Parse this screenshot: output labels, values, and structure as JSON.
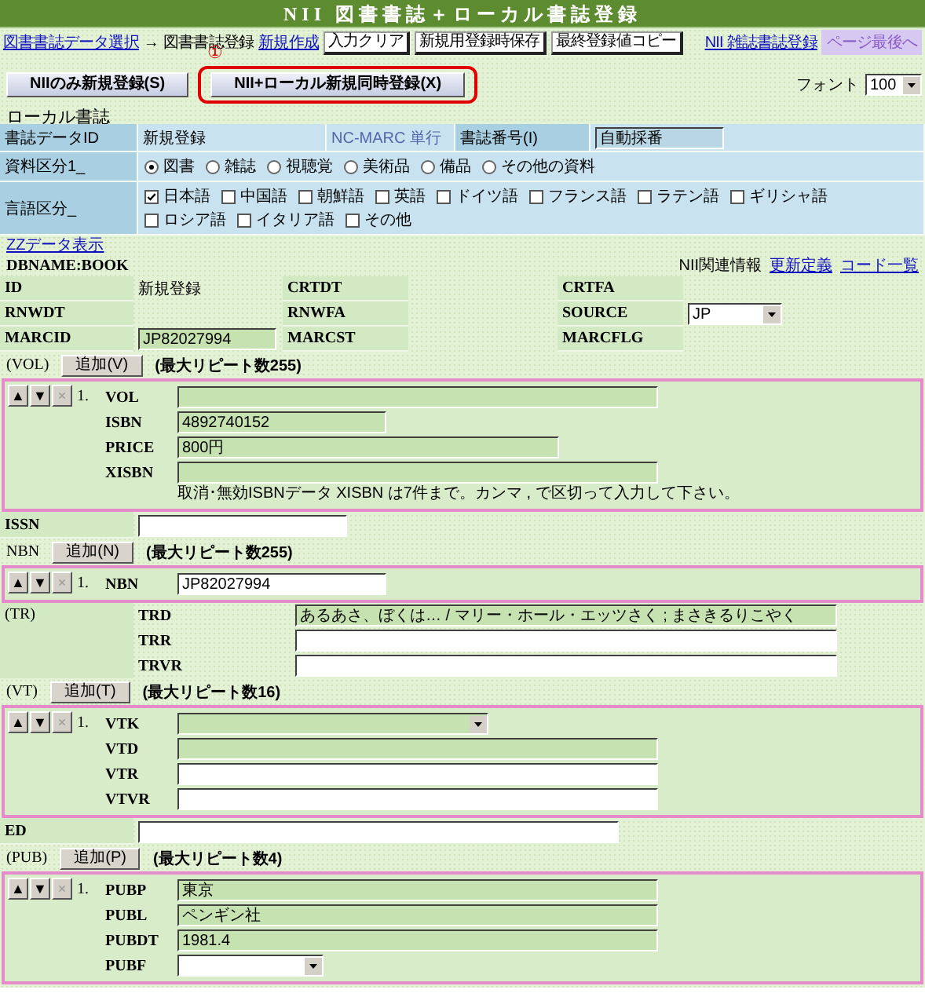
{
  "header": {
    "title": "NII 図書書誌＋ローカル書誌登録"
  },
  "nav": {
    "back_link": "図書書誌データ選択",
    "arrow": "→",
    "current": "図書書誌登録",
    "callout": "①",
    "new_link": "新規作成",
    "buttons": [
      "入力クリア",
      "新規用登録時保存",
      "最終登録値コピー"
    ],
    "serial_link": "NII 雑誌書誌登録",
    "bottom_link": "ページ最後へ"
  },
  "actions": {
    "buttons": [
      {
        "label": "NIIのみ新規登録(S)",
        "highlighted": false
      },
      {
        "label": "NII+ローカル新規同時登録(X)",
        "highlighted": true
      }
    ],
    "font_label": "フォント",
    "font_value": "100"
  },
  "local": {
    "heading": "ローカル書誌",
    "id_row": {
      "label": "書誌データID",
      "value": "新規登録",
      "source": "NC-MARC 単行",
      "number_label": "書誌番号(I)",
      "number_value": "自動採番"
    },
    "type_row": {
      "label": "資料区分1_",
      "options": [
        {
          "label": "図書",
          "selected": true
        },
        {
          "label": "雑誌",
          "selected": false
        },
        {
          "label": "視聴覚",
          "selected": false
        },
        {
          "label": "美術品",
          "selected": false
        },
        {
          "label": "備品",
          "selected": false
        },
        {
          "label": "その他の資料",
          "selected": false
        }
      ]
    },
    "lang_row": {
      "label": "言語区分_",
      "options": [
        {
          "label": "日本語",
          "checked": true
        },
        {
          "label": "中国語",
          "checked": false
        },
        {
          "label": "朝鮮語",
          "checked": false
        },
        {
          "label": "英語",
          "checked": false
        },
        {
          "label": "ドイツ語",
          "checked": false
        },
        {
          "label": "フランス語",
          "checked": false
        },
        {
          "label": "ラテン語",
          "checked": false
        },
        {
          "label": "ギリシャ語",
          "checked": false
        },
        {
          "label": "ロシア語",
          "checked": false
        },
        {
          "label": "イタリア語",
          "checked": false
        },
        {
          "label": "その他",
          "checked": false
        }
      ]
    }
  },
  "zz_link": "ZZデータ表示",
  "record": {
    "dbname": "DBNAME:BOOK",
    "info_label": "NII関連情報",
    "links": [
      "更新定義",
      "コード一覧"
    ],
    "rows": [
      {
        "cells": [
          {
            "label": "ID",
            "kind": "text",
            "value": "新規登録"
          },
          {
            "label": "CRTDT",
            "kind": "text"
          },
          {
            "label": "CRTFA",
            "kind": "text"
          }
        ]
      },
      {
        "cells": [
          {
            "label": "RNWDT",
            "kind": "text"
          },
          {
            "label": "RNWFA",
            "kind": "text"
          },
          {
            "label": "SOURCE",
            "kind": "select",
            "value": "JP"
          }
        ]
      },
      {
        "cells": [
          {
            "label": "MARCID",
            "kind": "input",
            "value": "JP82027994"
          },
          {
            "label": "MARCST",
            "kind": "text"
          },
          {
            "label": "MARCFLG",
            "kind": "text"
          }
        ]
      }
    ]
  },
  "sections": [
    {
      "kind": "repeat",
      "label": "(VOL)",
      "add_button": "追加(V)",
      "limit": "(最大リピート数255)",
      "entries": [
        {
          "controls": [
            {
              "label": "▲",
              "disabled": false
            },
            {
              "label": "▼",
              "disabled": false
            },
            {
              "label": "×",
              "disabled": true
            }
          ],
          "index": "1.",
          "fields": [
            {
              "label": "VOL",
              "kind": "input",
              "shaded": true
            },
            {
              "label": "ISBN",
              "kind": "input",
              "shaded": true,
              "value": "4892740152"
            },
            {
              "label": "PRICE",
              "kind": "input",
              "shaded": true,
              "value": "800円"
            },
            {
              "label": "XISBN",
              "kind": "input",
              "shaded": true
            }
          ],
          "note": "取消･無効ISBNデータ XISBN は7件まで。カンマ , で区切って入力して下さい。"
        }
      ]
    },
    {
      "kind": "field",
      "label": "ISSN",
      "shaded": false
    },
    {
      "kind": "repeat",
      "label": "NBN",
      "add_button": "追加(N)",
      "limit": "(最大リピート数255)",
      "entries": [
        {
          "controls": [
            {
              "label": "▲",
              "disabled": false
            },
            {
              "label": "▼",
              "disabled": false
            },
            {
              "label": "×",
              "disabled": true
            }
          ],
          "index": "1.",
          "fields": [
            {
              "label": "NBN",
              "kind": "input",
              "shaded": false,
              "value": "JP82027994"
            }
          ]
        }
      ]
    },
    {
      "kind": "group",
      "label": "(TR)",
      "fields": [
        {
          "label": "TRD",
          "shaded": true,
          "value": "あるあさ、ぼくは… / マリー・ホール・エッツさく ; まさきるりこやく"
        },
        {
          "label": "TRR",
          "shaded": false
        },
        {
          "label": "TRVR",
          "shaded": false
        }
      ]
    },
    {
      "kind": "repeat",
      "label": "(VT)",
      "add_button": "追加(T)",
      "limit": "(最大リピート数16)",
      "entries": [
        {
          "controls": [
            {
              "label": "▲",
              "disabled": false
            },
            {
              "label": "▼",
              "disabled": false
            },
            {
              "label": "×",
              "disabled": true
            }
          ],
          "index": "1.",
          "fields": [
            {
              "label": "VTK",
              "kind": "select",
              "shaded": true
            },
            {
              "label": "VTD",
              "kind": "input",
              "shaded": true
            },
            {
              "label": "VTR",
              "kind": "input",
              "shaded": false
            },
            {
              "label": "VTVR",
              "kind": "input",
              "shaded": false
            }
          ]
        }
      ]
    },
    {
      "kind": "field",
      "label": "ED",
      "shaded": false
    },
    {
      "kind": "repeat",
      "label": "(PUB)",
      "add_button": "追加(P)",
      "limit": "(最大リピート数4)",
      "entries": [
        {
          "controls": [
            {
              "label": "▲",
              "disabled": false
            },
            {
              "label": "▼",
              "disabled": false
            },
            {
              "label": "×",
              "disabled": true
            }
          ],
          "index": "1.",
          "fields": [
            {
              "label": "PUBP",
              "kind": "input",
              "shaded": true,
              "value": "東京"
            },
            {
              "label": "PUBL",
              "kind": "input",
              "shaded": true,
              "value": "ペンギン社"
            },
            {
              "label": "PUBDT",
              "kind": "input",
              "shaded": true,
              "value": "1981.4"
            },
            {
              "label": "PUBF",
              "kind": "select",
              "shaded": false
            }
          ]
        }
      ]
    }
  ]
}
